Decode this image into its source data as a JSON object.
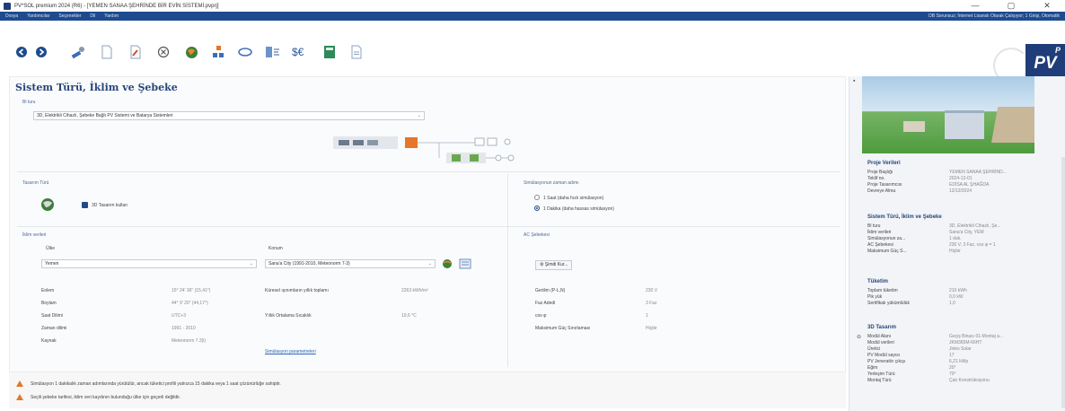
{
  "window": {
    "title": "PV*SOL premium 2024 (R6) - [YEMEN SANAA ŞEHRİNDE BİR EVİN SİSTEMİ.pvprj]",
    "controls": [
      "—",
      "▢",
      "✕"
    ]
  },
  "menu": {
    "items": [
      "Dosya",
      "Yardımcılar",
      "Seçenekler",
      "Dil",
      "Yardım"
    ],
    "right_text": "DB Sorunsuz; İnternet Lisanslı Olarak Çalışıyor; 1 Girişi, Otomatik"
  },
  "toolbar": {
    "icons": [
      "back-icon",
      "forward-icon",
      "wrench-icon",
      "page-icon",
      "edit-document-icon",
      "cancel-icon",
      "globe-icon",
      "pv-modules-icon",
      "ring-icon",
      "inverter-icon",
      "currency-icon",
      "calculator-icon",
      "report-icon"
    ],
    "logo": "PV",
    "logo_sup": "P"
  },
  "main": {
    "title": "Sistem Türü, İklim ve Şebeke",
    "system_type": {
      "label": "Bl turu",
      "value": "3D, Elektrikli Cihazlı, Şebeke Bağlı PV Sistemi ve Batarya Sistemleri"
    },
    "design_type": {
      "label": "Tasarım Türü",
      "checkbox_label": "3D Tasarım kullan"
    },
    "simulation": {
      "label": "Simülasyonun zaman adımı",
      "options": [
        "1 Saat (daha hızlı simülasyon)",
        "1 Dakika (daha hassas simülasyon)"
      ],
      "selected": 1
    },
    "climate": {
      "label": "İklim verileri",
      "country_label": "Ülke",
      "country": "Yemen",
      "location_label": "Konum",
      "location": "Sana'a City (1991-2010, Meteonorm 7-3)",
      "rows_left": [
        {
          "label": "Enlem",
          "value": "15° 24' 36\" (15,41°)"
        },
        {
          "label": "Boylam",
          "value": "44° 9' 20\" (44,17°)"
        },
        {
          "label": "Saat Dilimi",
          "value": "UTC+3"
        },
        {
          "label": "Zaman dilimi",
          "value": "1991 - 2010"
        },
        {
          "label": "Kaynak",
          "value": "Meteonorm 7.3(i)"
        }
      ],
      "rows_right": [
        {
          "label": "Küresel ışınımların yıllık toplamı",
          "value": "2263 kWh/m²"
        },
        {
          "label": "Yıllık Ortalama Sıcaklık",
          "value": "19,6 °C"
        }
      ],
      "link": "Simülasyon parametreleri"
    },
    "ac_grid": {
      "label": "AC Şebekesi",
      "button": "Şimdi Kur...",
      "rows": [
        {
          "label": "Gerilim (P-L,N)",
          "value": "230 V"
        },
        {
          "label": "Faz Adedi",
          "value": "3 Faz"
        },
        {
          "label": "cos φ",
          "value": "1"
        },
        {
          "label": "Maksimum Güç Sınırlaması",
          "value": "Hiçbir"
        }
      ]
    }
  },
  "warnings": [
    "Simülasyon 1 dakikalık zaman adımlarında yürütülür, ancak tüketici profili yalnızca 15 dakika veya 1 saat çözünürlüğe sahiptir.",
    "Seçili şebeke tarifesi, iklim veri kaydının bulunduğu ülke için geçerli değildir."
  ],
  "side": {
    "project": {
      "title": "Proje Verileri",
      "rows": [
        {
          "label": "Proje Başlığı",
          "value": "YEMEN SANAA ŞEHRİND..."
        },
        {
          "label": "Teklif no.",
          "value": "2024-12-01"
        },
        {
          "label": "Proje Tasarımcısı",
          "value": "EDİSA AL ŞHAĞDA"
        },
        {
          "label": "Devreye Alma",
          "value": "12/12/2024"
        }
      ]
    },
    "system": {
      "title": "Sistem Türü, İklim ve Şebeke",
      "rows": [
        {
          "label": "Bl turu",
          "value": "3D, Elektrikli Cihazlı, Şe..."
        },
        {
          "label": "İklim verileri",
          "value": "Sana'a City, YEM"
        },
        {
          "label": "Simülasyonun za...",
          "value": "1 dak."
        },
        {
          "label": "AC Şebekesi",
          "value": "230 V, 3 Faz, cos φ = 1"
        },
        {
          "label": "Maksimum Güç S...",
          "value": "Hiçbir"
        }
      ]
    },
    "consumption": {
      "title": "Tüketim",
      "rows": [
        {
          "label": "Toplam tüketim",
          "value": "210 kWh"
        },
        {
          "label": "Pik yük",
          "value": "0,0 kW"
        },
        {
          "label": "Sertifikalı yükümlülük",
          "value": "1,0"
        }
      ]
    },
    "design3d": {
      "title": "3D Tasarım",
      "rows": [
        {
          "label": "Modül Alanı",
          "value": "Geçiş Binası 01-Montaj a..."
        },
        {
          "label": "Modül verileri",
          "value": "JKM365M-66HT"
        },
        {
          "label": "Üretici",
          "value": "Jinko Solar"
        },
        {
          "label": "PV Modül sayısı",
          "value": "17"
        },
        {
          "label": "PV Jeneratör çıkışı",
          "value": "6,21 kWp"
        },
        {
          "label": "Eğim",
          "value": "20°"
        },
        {
          "label": "Yerleşim Türü",
          "value": "70°"
        },
        {
          "label": "Montaj Türü",
          "value": "Çatı Konstrüksiyonu"
        }
      ]
    }
  }
}
